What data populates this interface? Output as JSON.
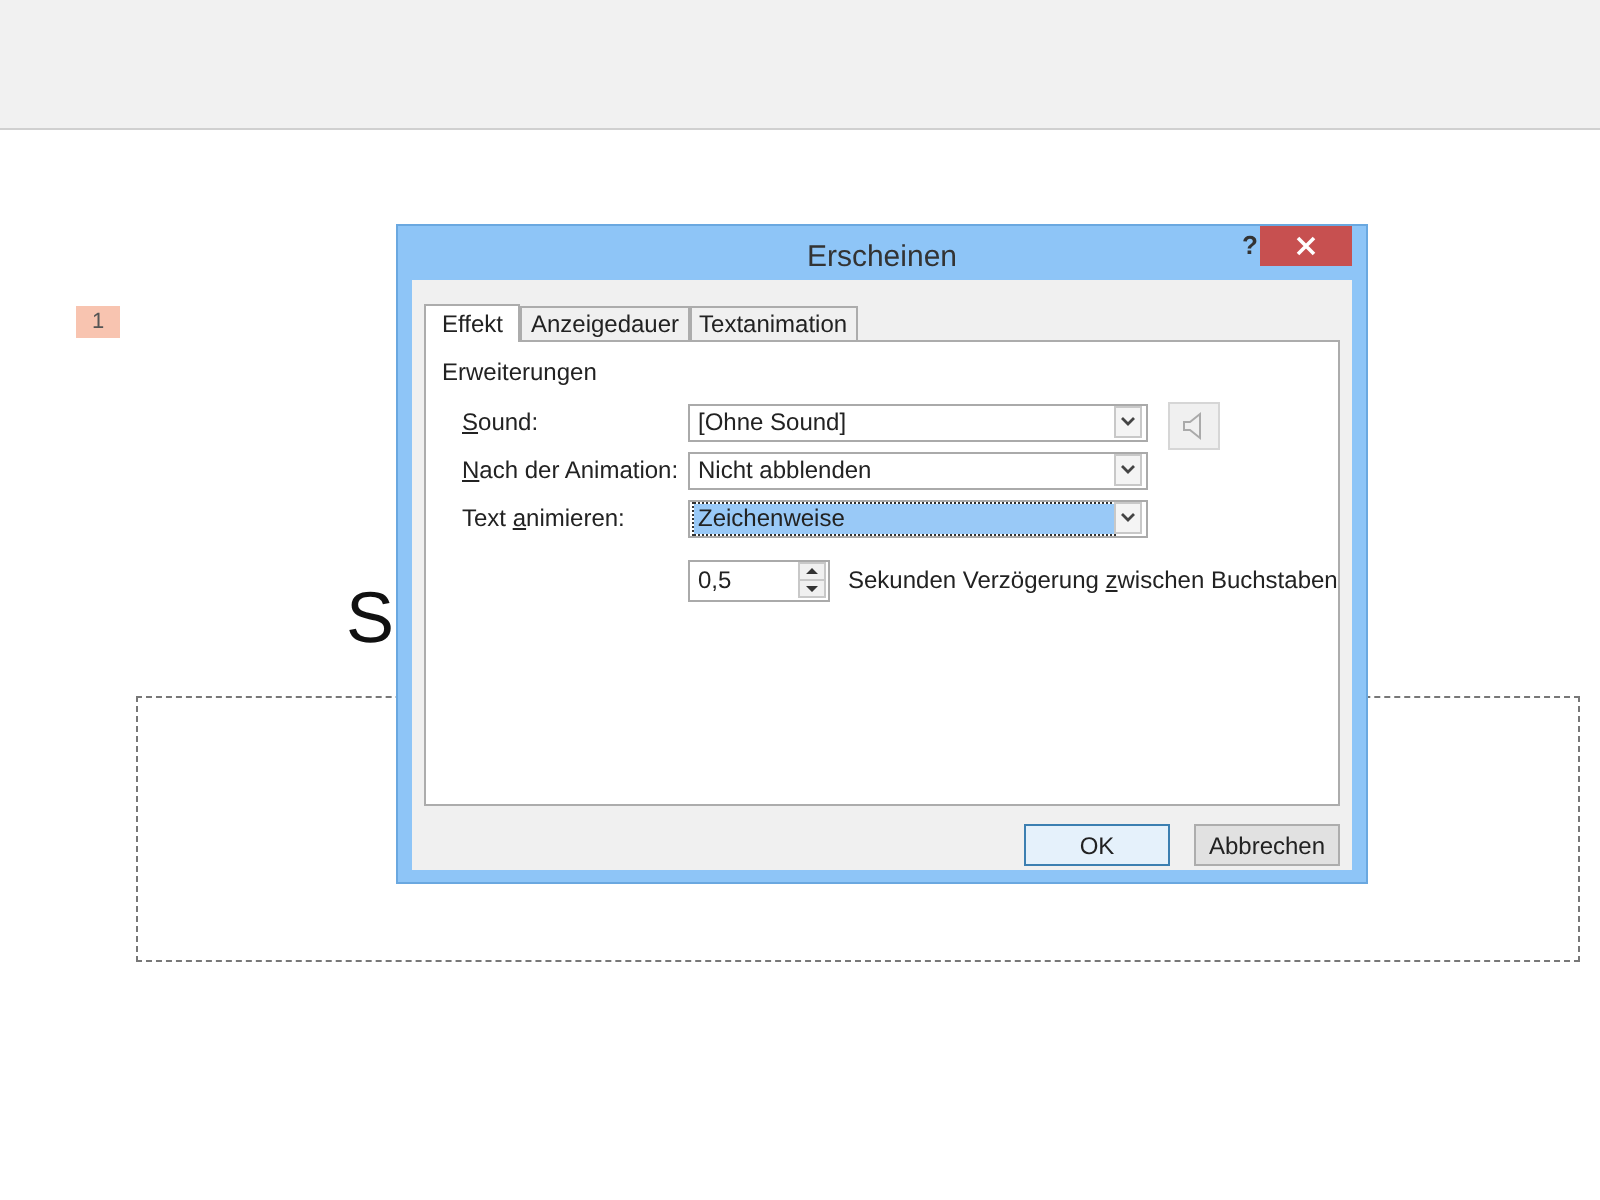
{
  "slide": {
    "badge": "1",
    "title_fragment": "S"
  },
  "dialog": {
    "title": "Erscheinen",
    "help": "?",
    "tabs": [
      {
        "label": "Effekt",
        "selected": true
      },
      {
        "label": "Anzeigedauer",
        "selected": false
      },
      {
        "label": "Textanimation",
        "selected": false
      }
    ],
    "group": "Erweiterungen",
    "rows": [
      {
        "label": {
          "key": "S",
          "after": "ound:"
        },
        "value": "[Ohne Sound]",
        "focused": false,
        "speaker": true
      },
      {
        "label": {
          "key": "N",
          "after": "ach der Animation:"
        },
        "value": "Nicht abblenden",
        "focused": false,
        "speaker": false
      },
      {
        "label": {
          "before": "Text ",
          "key": "a",
          "after": "nimieren:"
        },
        "value": "Zeichenweise",
        "focused": true,
        "speaker": false
      }
    ],
    "delay": {
      "value": "0,5",
      "label": [
        "Sekunden Verzögerung ",
        "z",
        "wischen Buchstaben"
      ]
    },
    "buttons": [
      {
        "label": "OK",
        "default": true
      },
      {
        "label": "Abbrechen",
        "default": false
      }
    ]
  }
}
